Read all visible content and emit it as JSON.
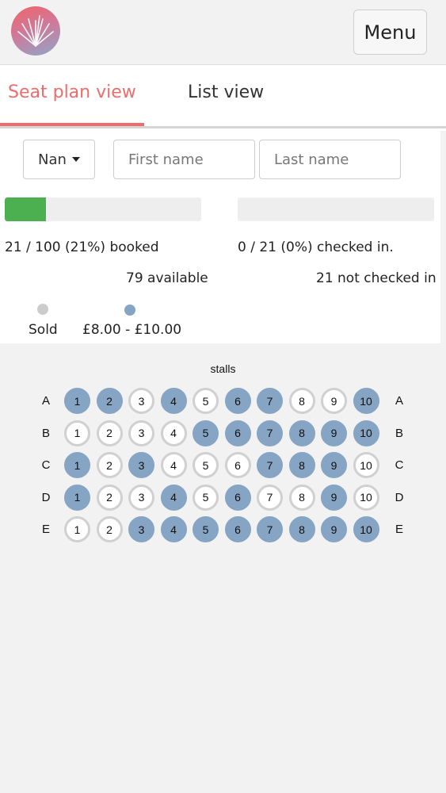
{
  "header": {
    "menu_label": "Menu"
  },
  "tabs": [
    {
      "label": "Seat plan view",
      "active": true
    },
    {
      "label": "List view",
      "active": false
    }
  ],
  "search": {
    "dropdown_value": "Nan",
    "first_name_placeholder": "First name",
    "last_name_placeholder": "Last name"
  },
  "stats": {
    "booked_text": "21 / 100 (21%) booked",
    "booked_fraction": 0.21,
    "available_text": "79 available",
    "checked_text": "0 / 21 (0%) checked in.",
    "checked_fraction": 0,
    "not_checked_text": "21 not checked in"
  },
  "legend": [
    {
      "label": "Sold",
      "color": "#cccccc"
    },
    {
      "label": "£8.00 - £10.00",
      "color": "#86a4c3"
    }
  ],
  "colors": {
    "accent": "#ef6c6c",
    "progress": "#4cb050",
    "seat_available": "#86a4c3",
    "seat_sold_border": "#d0d0d0"
  },
  "section": "stalls",
  "rows": [
    {
      "label": "A",
      "seats": [
        {
          "n": "1",
          "status": "available"
        },
        {
          "n": "2",
          "status": "available"
        },
        {
          "n": "3",
          "status": "sold"
        },
        {
          "n": "4",
          "status": "available"
        },
        {
          "n": "5",
          "status": "sold"
        },
        {
          "n": "6",
          "status": "available"
        },
        {
          "n": "7",
          "status": "available"
        },
        {
          "n": "8",
          "status": "sold"
        },
        {
          "n": "9",
          "status": "sold"
        },
        {
          "n": "10",
          "status": "available"
        }
      ]
    },
    {
      "label": "B",
      "seats": [
        {
          "n": "1",
          "status": "sold"
        },
        {
          "n": "2",
          "status": "sold"
        },
        {
          "n": "3",
          "status": "sold"
        },
        {
          "n": "4",
          "status": "sold"
        },
        {
          "n": "5",
          "status": "available"
        },
        {
          "n": "6",
          "status": "available"
        },
        {
          "n": "7",
          "status": "available"
        },
        {
          "n": "8",
          "status": "available"
        },
        {
          "n": "9",
          "status": "available"
        },
        {
          "n": "10",
          "status": "available"
        }
      ]
    },
    {
      "label": "C",
      "seats": [
        {
          "n": "1",
          "status": "available"
        },
        {
          "n": "2",
          "status": "sold"
        },
        {
          "n": "3",
          "status": "available"
        },
        {
          "n": "4",
          "status": "sold"
        },
        {
          "n": "5",
          "status": "sold"
        },
        {
          "n": "6",
          "status": "sold"
        },
        {
          "n": "7",
          "status": "available"
        },
        {
          "n": "8",
          "status": "available"
        },
        {
          "n": "9",
          "status": "available"
        },
        {
          "n": "10",
          "status": "sold"
        }
      ]
    },
    {
      "label": "D",
      "seats": [
        {
          "n": "1",
          "status": "available"
        },
        {
          "n": "2",
          "status": "sold"
        },
        {
          "n": "3",
          "status": "sold"
        },
        {
          "n": "4",
          "status": "available"
        },
        {
          "n": "5",
          "status": "sold"
        },
        {
          "n": "6",
          "status": "available"
        },
        {
          "n": "7",
          "status": "sold"
        },
        {
          "n": "8",
          "status": "sold"
        },
        {
          "n": "9",
          "status": "available"
        },
        {
          "n": "10",
          "status": "sold"
        }
      ]
    },
    {
      "label": "E",
      "seats": [
        {
          "n": "1",
          "status": "sold"
        },
        {
          "n": "2",
          "status": "sold"
        },
        {
          "n": "3",
          "status": "available"
        },
        {
          "n": "4",
          "status": "available"
        },
        {
          "n": "5",
          "status": "available"
        },
        {
          "n": "6",
          "status": "available"
        },
        {
          "n": "7",
          "status": "available"
        },
        {
          "n": "8",
          "status": "available"
        },
        {
          "n": "9",
          "status": "available"
        },
        {
          "n": "10",
          "status": "available"
        }
      ]
    }
  ]
}
